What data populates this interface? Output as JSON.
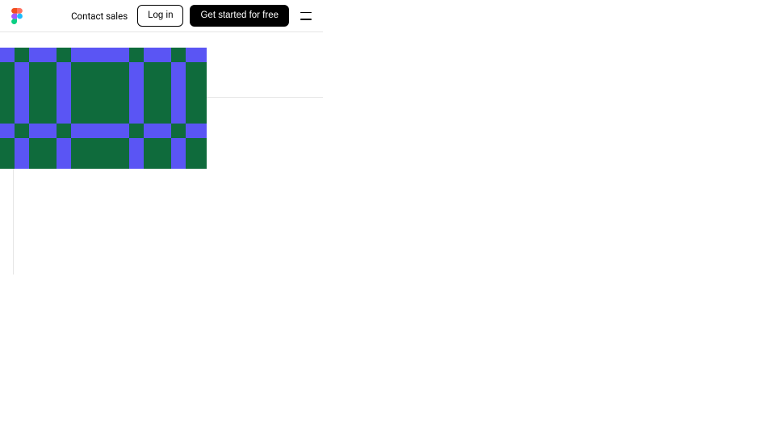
{
  "header": {
    "contact_label": "Contact sales",
    "login_label": "Log in",
    "cta_label": "Get started for free"
  },
  "colors": {
    "green": "#0f6b3c",
    "blue": "#5a55f4"
  }
}
